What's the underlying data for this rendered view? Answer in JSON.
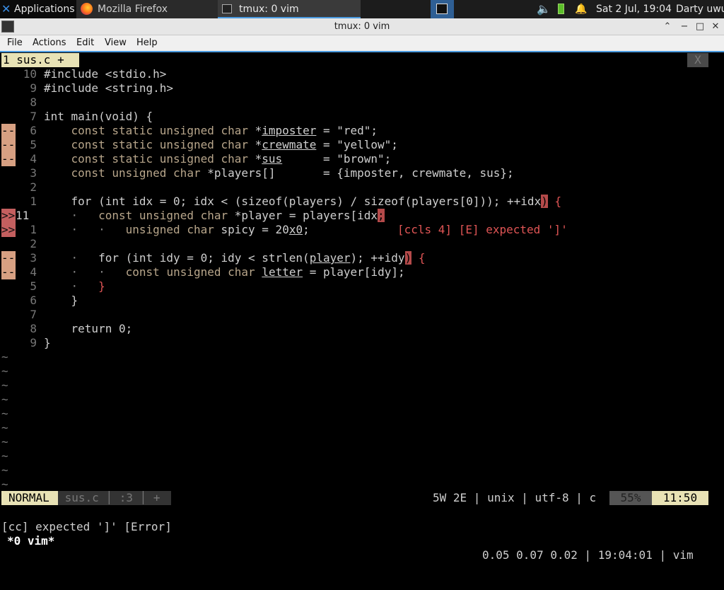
{
  "panel": {
    "applications_label": "Applications",
    "tasks": [
      {
        "label": "Mozilla Firefox"
      },
      {
        "label": "tmux: 0 vim"
      }
    ],
    "clock": "Sat  2 Jul, 19:04",
    "user": "Darty uwu"
  },
  "window": {
    "title": "tmux: 0 vim",
    "btn_min": "⌃",
    "btn_restore": "−",
    "btn_max": "□",
    "btn_close": "✕"
  },
  "menubar": {
    "file": "File",
    "actions": "Actions",
    "edit": "Edit",
    "view": "View",
    "help": "Help"
  },
  "vim": {
    "tab_label": "1 sus.c +",
    "tab_close": "X",
    "lines": [
      {
        "sign": "",
        "num": "10",
        "text": "#include <stdio.h>"
      },
      {
        "sign": "",
        "num": "9",
        "text": "#include <string.h>"
      },
      {
        "sign": "",
        "num": "8",
        "text": ""
      },
      {
        "sign": "",
        "num": "7",
        "text": "int main(void) {"
      },
      {
        "sign": "--",
        "num": "6",
        "text": "    const static unsigned char *imposter = \"red\";"
      },
      {
        "sign": "--",
        "num": "5",
        "text": "    const static unsigned char *crewmate = \"yellow\";"
      },
      {
        "sign": "--",
        "num": "4",
        "text": "    const static unsigned char *sus      = \"brown\";"
      },
      {
        "sign": "",
        "num": "3",
        "text": "    const unsigned char *players[]       = {imposter, crewmate, sus};"
      },
      {
        "sign": "",
        "num": "2",
        "text": ""
      },
      {
        "sign": "",
        "num": "1",
        "text": "    for (int idx = 0; idx < (sizeof(players) / sizeof(players[0])); ++idx) {"
      },
      {
        "sign": ">>",
        "num": "11",
        "text": "    ·   const unsigned char *player = players[idx;"
      },
      {
        "sign": ">>",
        "num": "1",
        "text": "    ·   ·   unsigned char spicy = 20x0;"
      },
      {
        "sign": "",
        "num": "2",
        "text": ""
      },
      {
        "sign": "--",
        "num": "3",
        "text": "    ·   for (int idy = 0; idy < strlen(player); ++idy) {"
      },
      {
        "sign": "--",
        "num": "4",
        "text": "    ·   ·   const unsigned char letter = player[idy];"
      },
      {
        "sign": "",
        "num": "5",
        "text": "    ·   }"
      },
      {
        "sign": "",
        "num": "6",
        "text": "    }"
      },
      {
        "sign": "",
        "num": "7",
        "text": ""
      },
      {
        "sign": "",
        "num": "8",
        "text": "    return 0;"
      },
      {
        "sign": "",
        "num": "9",
        "text": "}"
      }
    ],
    "virtual_text": "[ccls 4] [E] expected ']'",
    "tilde": "~",
    "status": {
      "mode": "NORMAL",
      "file": "sus.c",
      "bufnr": ":3",
      "modified": "+",
      "info": "5W 2E | unix | utf-8 | c",
      "percent": "55%",
      "position": "11:50"
    },
    "cmdline": "[cc] expected ']' [Error]"
  },
  "tmux": {
    "window": "*0 vim*",
    "right": "0.05 0.07 0.02 | 19:04:01 | vim"
  }
}
